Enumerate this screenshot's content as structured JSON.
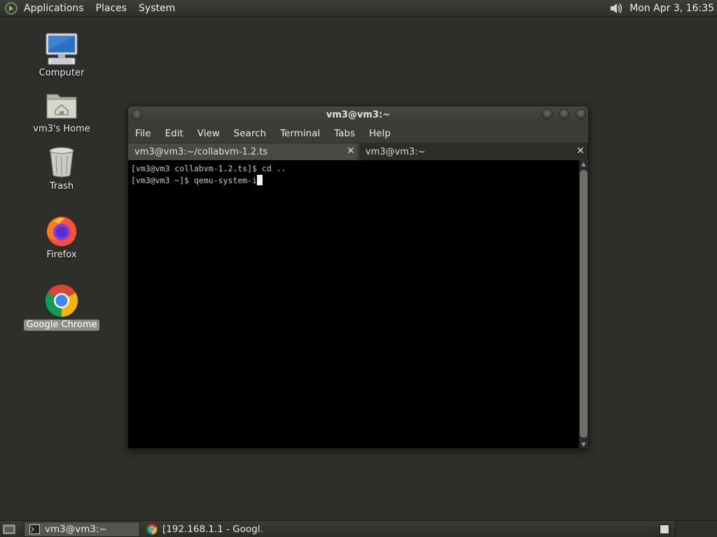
{
  "top_panel": {
    "menus": [
      "Applications",
      "Places",
      "System"
    ],
    "clock": "Mon Apr  3, 16:35",
    "icons": {
      "logo": "gnome-foot-icon",
      "volume": "volume-icon"
    }
  },
  "desktop_icons": [
    {
      "label": "Computer",
      "icon": "computer-icon"
    },
    {
      "label": "vm3's Home",
      "icon": "home-folder-icon"
    },
    {
      "label": "Trash",
      "icon": "trash-icon"
    },
    {
      "label": "Firefox",
      "icon": "firefox-icon"
    },
    {
      "label": "Google Chrome",
      "icon": "chrome-icon",
      "selected": true
    }
  ],
  "terminal": {
    "title": "vm3@vm3:~",
    "menu": [
      "File",
      "Edit",
      "View",
      "Search",
      "Terminal",
      "Tabs",
      "Help"
    ],
    "tabs": [
      {
        "label": "vm3@vm3:~/collabvm-1.2.ts"
      },
      {
        "label": "vm3@vm3:~"
      }
    ],
    "lines": [
      "[vm3@vm3 collabvm-1.2.ts]$ cd ..",
      "[vm3@vm3 ~]$ qemu-system-i"
    ]
  },
  "taskbar": {
    "tasks": [
      {
        "label": "vm3@vm3:~",
        "icon": "terminal-icon",
        "active": true
      },
      {
        "label": "[192.168.1.1 - Googl…",
        "icon": "chrome-icon",
        "active": false
      }
    ]
  },
  "colors": {
    "desktop_bg": "#2e2e2b",
    "panel_bg": "#35352f",
    "terminal_bg": "#000000",
    "chrome_red": "#db4437",
    "chrome_yellow": "#f4b400",
    "chrome_green": "#0f9d58",
    "chrome_blue": "#4285f4"
  }
}
